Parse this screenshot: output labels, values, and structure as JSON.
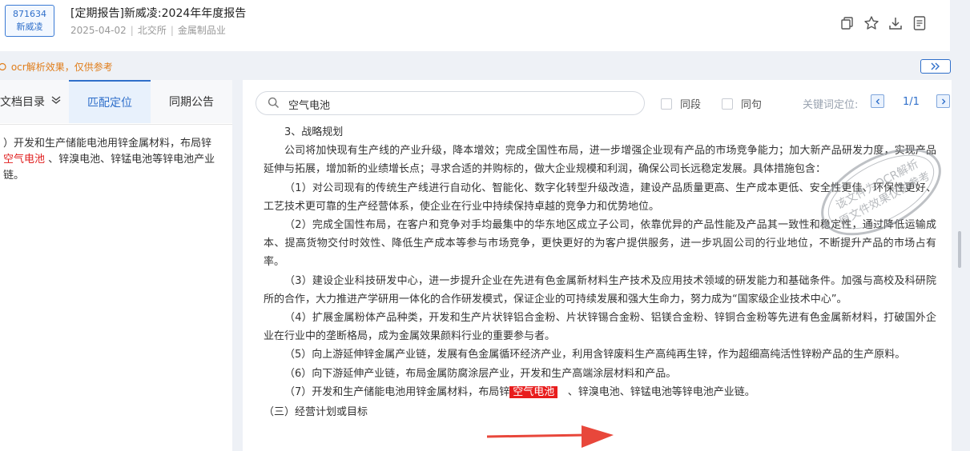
{
  "header": {
    "stock_code": "871634",
    "stock_name": "新威凌",
    "title": "[定期报告]新威凌:2024年年度报告",
    "date": "2025-04-02",
    "exchange": "北交所",
    "industry": "金属制品业",
    "actions": [
      "copy-icon",
      "star-icon",
      "download-icon",
      "document-icon"
    ]
  },
  "notice": {
    "text": "ocr解析效果，仅供参考",
    "color": "#e07d1a"
  },
  "left_panel": {
    "tabs": [
      {
        "label": "文档目录"
      },
      {
        "label": "匹配定位"
      },
      {
        "label": "同期公告"
      }
    ],
    "result": {
      "before": "）开发和生产储能电池用锌金属材料，布局锌 ",
      "keyword": "空气电池",
      "after": " 、锌溴电池、锌锰电池等锌电池产业链。"
    }
  },
  "search": {
    "value": "空气电池",
    "option_paragraph": "同段",
    "option_sentence": "同句",
    "keyword_locate_label": "关键词定位:",
    "position": "1/1"
  },
  "document": {
    "heading": "3、战略规划",
    "intro": "公司将加快现有生产线的产业升级，降本增效；完成全国性布局，进一步增强企业现有产品的市场竞争能力；加大新产品研发力度，实现产品延伸与拓展，增加新的业绩增长点；寻求合适的并购标的，做大企业规模和利润，确保公司长远稳定发展。具体措施包含：",
    "items": [
      "（1）对公司现有的传统生产线进行自动化、智能化、数字化转型升级改造，建设产品质量更高、生产成本更低、安全性更佳、环保性更好、工艺技术更可靠的生产经营体系，使企业在行业中持续保持卓越的竞争力和优势地位。",
      "（2）完成全国性布局，在客户和竞争对手均最集中的华东地区成立子公司，依靠优异的产品性能及产品其一致性和稳定性，通过降低运输成本、提高货物交付时效性、降低生产成本等参与市场竞争，更快更好的为客户提供服务，进一步巩固公司的行业地位，不断提升产品的市场占有率。",
      "（3）建设企业科技研发中心，进一步提升企业在先进有色金属新材料生产技术及应用技术领域的研发能力和基础条件。加强与高校及科研院所的合作，大力推进产学研用一体化的合作研发模式，保证企业的可持续发展和强大生命力，努力成为“国家级企业技术中心”。",
      "（4）扩展金属粉体产品种类，开发和生产片状锌铝合金粉、片状锌锡合金粉、铝镁合金粉、锌铜合金粉等先进有色金属新材料，打破国外企业在行业中的垄断格局，成为金属效果颜料行业的重要参与者。",
      "（5）向上游延伸锌金属产业链，发展有色金属循环经济产业，利用含锌废料生产高纯再生锌，作为超细高纯活性锌粉产品的生产原料。",
      "（6）向下游延伸产业链，布局金属防腐涂层产业，开发和生产高端涂层材料和产品。"
    ],
    "item7_before": "（7）开发和生产储能电池用锌金属材料，布局锌",
    "item7_keyword": "空气电池",
    "item7_after": "、锌溴电池、锌锰电池等锌电池产业链。",
    "next_section": "（三）经营计划或目标"
  },
  "watermark": {
    "line1": "该文件为OCR解析",
    "line2": "原文件效果仅供参考"
  },
  "colors": {
    "accent": "#2f6fca",
    "highlight": "#e81d1d",
    "notice": "#e07d1a"
  }
}
